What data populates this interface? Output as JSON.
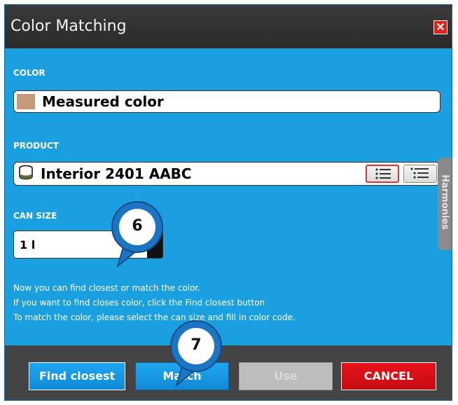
{
  "window": {
    "title": "Color Matching",
    "close_label": "✕"
  },
  "color_section": {
    "label": "COLOR",
    "value": "Measured color",
    "swatch_color": "#c49b7a"
  },
  "product_section": {
    "label": "PRODUCT",
    "value": "Interior 2401 AABC"
  },
  "side_tab": {
    "label": "Harmonies"
  },
  "can_size": {
    "label": "CAN SIZE",
    "value": "1 l"
  },
  "info_lines": [
    "Now you can find closest or match the color.",
    "If you want to find closes color, click the Find closest button",
    "To match the color, please select the can size and fill in color code."
  ],
  "buttons": {
    "find_closest": "Find closest",
    "match": "Match",
    "use": "Use",
    "cancel": "CANCEL"
  },
  "callouts": {
    "step6": "6",
    "step7": "7"
  },
  "colors": {
    "dialog_bg": "#1aa0e0",
    "titlebar": "#333333",
    "footer": "#444444",
    "cancel": "#d4121a",
    "accent_blue": "#1799e3"
  }
}
